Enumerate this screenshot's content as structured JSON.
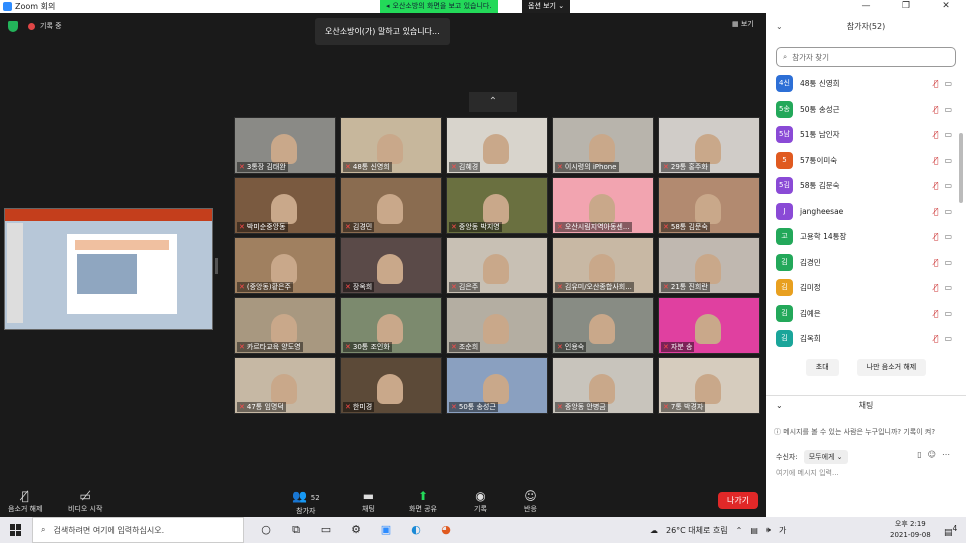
{
  "window": {
    "title": "Zoom 회의",
    "buttons": [
      "—",
      "❐",
      "✕"
    ]
  },
  "banner": {
    "text": "오산소방의 화면을 보고 있습니다.",
    "view_options": "옵션 보기 ⌄"
  },
  "stage": {
    "recording": "기록 중",
    "speaking": "오산소방이(가) 말하고 있습니다...",
    "view": "보기",
    "up": "⌃"
  },
  "tiles": [
    {
      "name": "3통장 김태완",
      "bg": "#8a8a86"
    },
    {
      "name": "48통 신영희",
      "bg": "#c7b79c"
    },
    {
      "name": "김혜경",
      "bg": "#d8d4cc"
    },
    {
      "name": "이시령의 iPhone",
      "bg": "#b8b4ac"
    },
    {
      "name": "29통 홍주화",
      "bg": "#d0ccc8"
    },
    {
      "name": "박미순중앙동",
      "bg": "#7a5a40"
    },
    {
      "name": "김경민",
      "bg": "#8a6c50"
    },
    {
      "name": "중앙동 박지영",
      "bg": "#6a7040"
    },
    {
      "name": "오산시림지역아동센...",
      "bg": "#f2a4b0"
    },
    {
      "name": "58통 김문숙",
      "bg": "#b28a70"
    },
    {
      "name": "(중앙동)황은주",
      "bg": "#a08060"
    },
    {
      "name": "장옥희",
      "bg": "#5a4a48"
    },
    {
      "name": "김은주",
      "bg": "#c8c0b4"
    },
    {
      "name": "김유미/오산종합사회...",
      "bg": "#c8b8a4"
    },
    {
      "name": "21통 진희란",
      "bg": "#c0b8b0"
    },
    {
      "name": "카르타교육 양도영",
      "bg": "#a89880"
    },
    {
      "name": "30통 조인화",
      "bg": "#7c8a6e"
    },
    {
      "name": "조순희",
      "bg": "#b4aea2"
    },
    {
      "name": "인용숙",
      "bg": "#888c84"
    },
    {
      "name": "자분 송",
      "bg": "#e040a0"
    },
    {
      "name": "47통 임명덕",
      "bg": "#c6b8a4"
    },
    {
      "name": "한미경",
      "bg": "#5c4a38"
    },
    {
      "name": "50통 송성근",
      "bg": "#8aa0c0"
    },
    {
      "name": "중앙동 안병금",
      "bg": "#c8c4bc"
    },
    {
      "name": "7통 박경자",
      "bg": "#d6ccbe"
    }
  ],
  "toolbar": {
    "unmute": "음소거 해제",
    "start_video": "비디오 시작",
    "participants": "참가자",
    "participants_count": "52",
    "chat": "채팅",
    "share": "화면 공유",
    "record": "기록",
    "reactions": "반응",
    "leave": "나가기"
  },
  "panel": {
    "title": "참가자(52)",
    "search_placeholder": "참가자 찾기",
    "participants": [
      {
        "initial": "4신",
        "name": "48통 신영희",
        "color": "#2d6fd6"
      },
      {
        "initial": "5송",
        "name": "50통 송성근",
        "color": "#23a85a"
      },
      {
        "initial": "5남",
        "name": "51통 남인자",
        "color": "#8a4ad6"
      },
      {
        "initial": "5",
        "name": "57통이미숙",
        "color": "#e05a20"
      },
      {
        "initial": "5김",
        "name": "58통 김문숙",
        "color": "#8a4ad6"
      },
      {
        "initial": "J",
        "name": "jangheesae",
        "color": "#8a4ad6"
      },
      {
        "initial": "고",
        "name": "고용학 14통장",
        "color": "#23a85a"
      },
      {
        "initial": "김",
        "name": "김경민",
        "color": "#23a85a"
      },
      {
        "initial": "김",
        "name": "김미정",
        "color": "#e8a020"
      },
      {
        "initial": "김",
        "name": "김예은",
        "color": "#23a85a"
      },
      {
        "initial": "김",
        "name": "김옥희",
        "color": "#1aa59a"
      }
    ],
    "invite": "초대",
    "unmute_me": "나만 음소거 해제",
    "chat_title": "채팅",
    "chat_note": "메시지를 볼 수 있는 사람은 누구입니까? 기록이 켜?",
    "to_label": "수신자:",
    "to_value": "모두에게 ⌄",
    "input_placeholder": "여기에 메시지 입력..."
  },
  "taskbar": {
    "search": "검색하려면 여기에 입력하십시오.",
    "weather": "26°C 대체로 흐림",
    "ime": "가",
    "time": "오후 2:19",
    "date": "2021-09-08",
    "notif": "4"
  }
}
